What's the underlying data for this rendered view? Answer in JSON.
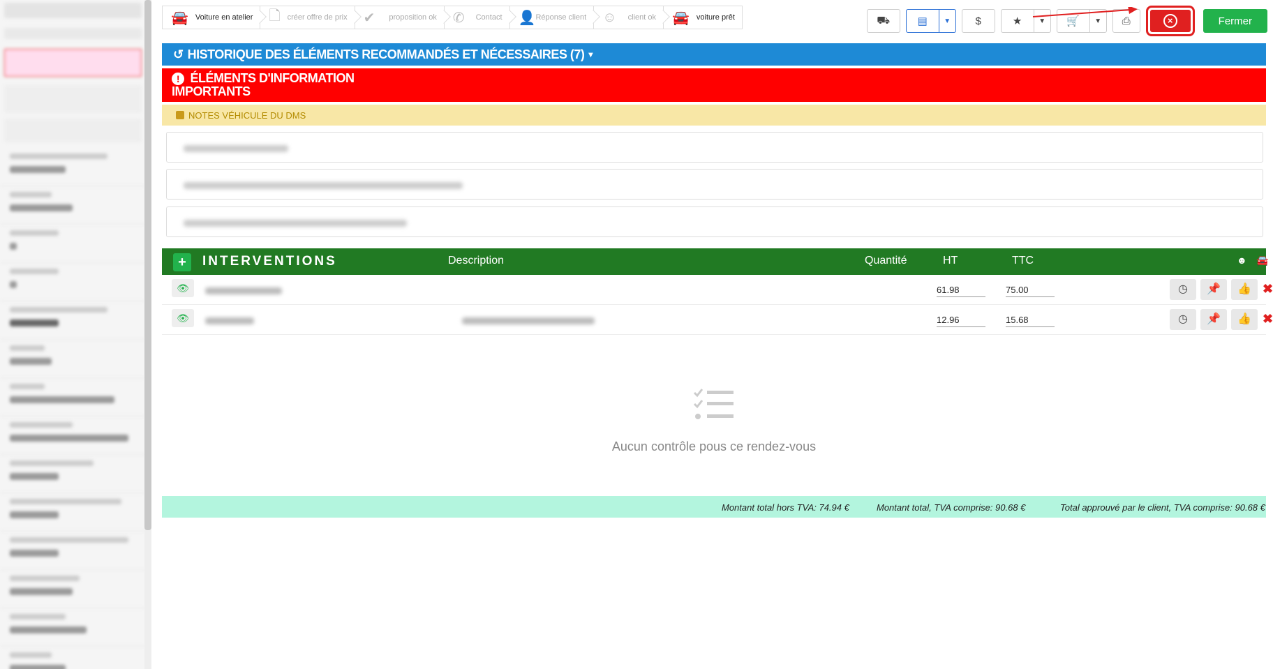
{
  "steps": [
    {
      "label": "Voiture en atelier",
      "icon": "car-icon",
      "active": true
    },
    {
      "label": "créer offre de prix",
      "icon": "document-icon",
      "active": false
    },
    {
      "label": "proposition ok",
      "icon": "check-icon",
      "active": false
    },
    {
      "label": "Contact",
      "icon": "phone-icon",
      "active": false
    },
    {
      "label": "Réponse client",
      "icon": "user-check-icon",
      "active": false
    },
    {
      "label": "client ok",
      "icon": "smile-icon",
      "active": false
    },
    {
      "label": "voiture prêt",
      "icon": "car-icon",
      "active": true
    }
  ],
  "actions": {
    "dollar": "$",
    "fermer": "Fermer"
  },
  "historique": {
    "title": "HISTORIQUE DES ÉLÉMENTS RECOMMANDÉS ET NÉCESSAIRES (7)"
  },
  "info": {
    "line1": "ÉLÉMENTS D'INFORMATION",
    "line2": "IMPORTANTS"
  },
  "notes": {
    "title": "NOTES VÉHICULE DU DMS"
  },
  "interventions": {
    "title": "INTERVENTIONS",
    "col_description": "Description",
    "col_quantite": "Quantité",
    "col_ht": "HT",
    "col_ttc": "TTC",
    "rows": [
      {
        "ht": "61.98",
        "ttc": "75.00"
      },
      {
        "ht": "12.96",
        "ttc": "15.68"
      }
    ]
  },
  "empty": {
    "message": "Aucun contrôle pous ce rendez-vous"
  },
  "totals": {
    "ht": "Montant total hors TVA: 74.94 €",
    "ttc": "Montant total, TVA comprise: 90.68 €",
    "approved": "Total approuvé par le client, TVA comprise: 90.68 €"
  },
  "colors": {
    "historique": "#1e8ad6",
    "info": "#ff0000",
    "notes": "#f8e7a6",
    "interventions": "#217a23",
    "fermer": "#22b24c",
    "close": "#e02020",
    "totals": "#b3f5de"
  }
}
